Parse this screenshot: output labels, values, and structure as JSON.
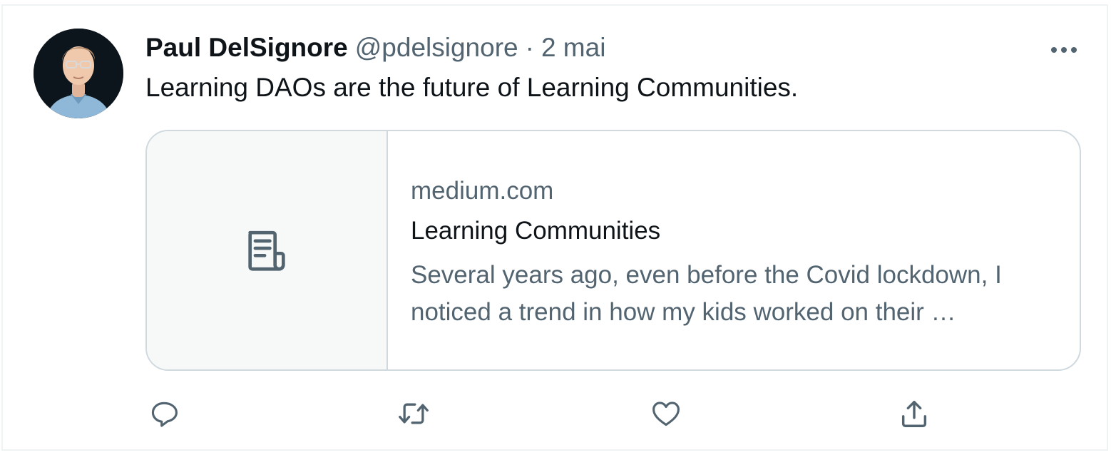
{
  "tweet": {
    "author_name": "Paul DelSignore",
    "author_handle": "@pdelsignore",
    "separator": "·",
    "timestamp": "2 mai",
    "text": "Learning DAOs are the future of Learning Communities.",
    "avatar_icon": "avatar-illustration",
    "more_icon": "more-horizontal-icon"
  },
  "link_card": {
    "thumbnail_icon": "article-icon",
    "domain": "medium.com",
    "title": "Learning Communities",
    "description": "Several years ago, even before the Covid lockdown, I noticed a trend in how my kids worked on their …"
  },
  "actions": [
    {
      "icon": "reply-icon"
    },
    {
      "icon": "retweet-icon"
    },
    {
      "icon": "like-icon"
    },
    {
      "icon": "share-icon"
    }
  ],
  "colors": {
    "text_primary": "#0f1419",
    "text_secondary": "#536471",
    "border": "#cfd9de",
    "card_thumb_bg": "#f7f9f9"
  }
}
